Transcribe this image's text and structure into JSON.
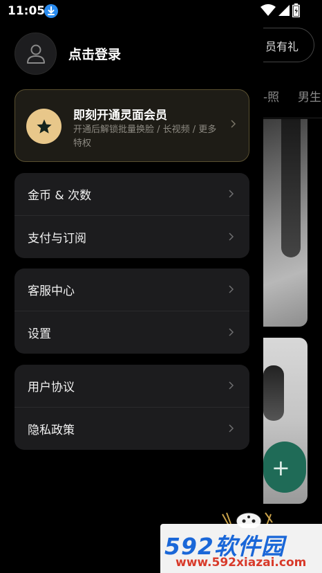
{
  "status_bar": {
    "time": "11:05",
    "icons": [
      "download-icon",
      "wifi-icon",
      "signal-icon",
      "battery-icon"
    ]
  },
  "drawer": {
    "profile": {
      "login_label": "点击登录",
      "avatar_icon": "user-icon"
    },
    "vip": {
      "title": "即刻开通灵面会员",
      "description": "开通后解锁批量换脸 / 长视频 / 更多特权",
      "badge_icon": "star-icon",
      "accent": "#e8c78a"
    },
    "menu_groups": [
      {
        "items": [
          {
            "label": "金币 & 次数"
          },
          {
            "label": "支付与订阅"
          }
        ]
      },
      {
        "items": [
          {
            "label": "客服中心"
          },
          {
            "label": "设置"
          }
        ]
      },
      {
        "items": [
          {
            "label": "用户协议"
          },
          {
            "label": "隐私政策"
          }
        ]
      }
    ]
  },
  "background": {
    "promo_text": "员有礼",
    "tabs": [
      "-照",
      "男生"
    ],
    "fab_icon": "plus-icon",
    "fab_color": "#1f6b57"
  },
  "watermark": {
    "brand": "592软件园",
    "url": "www.592xiazai.com"
  }
}
